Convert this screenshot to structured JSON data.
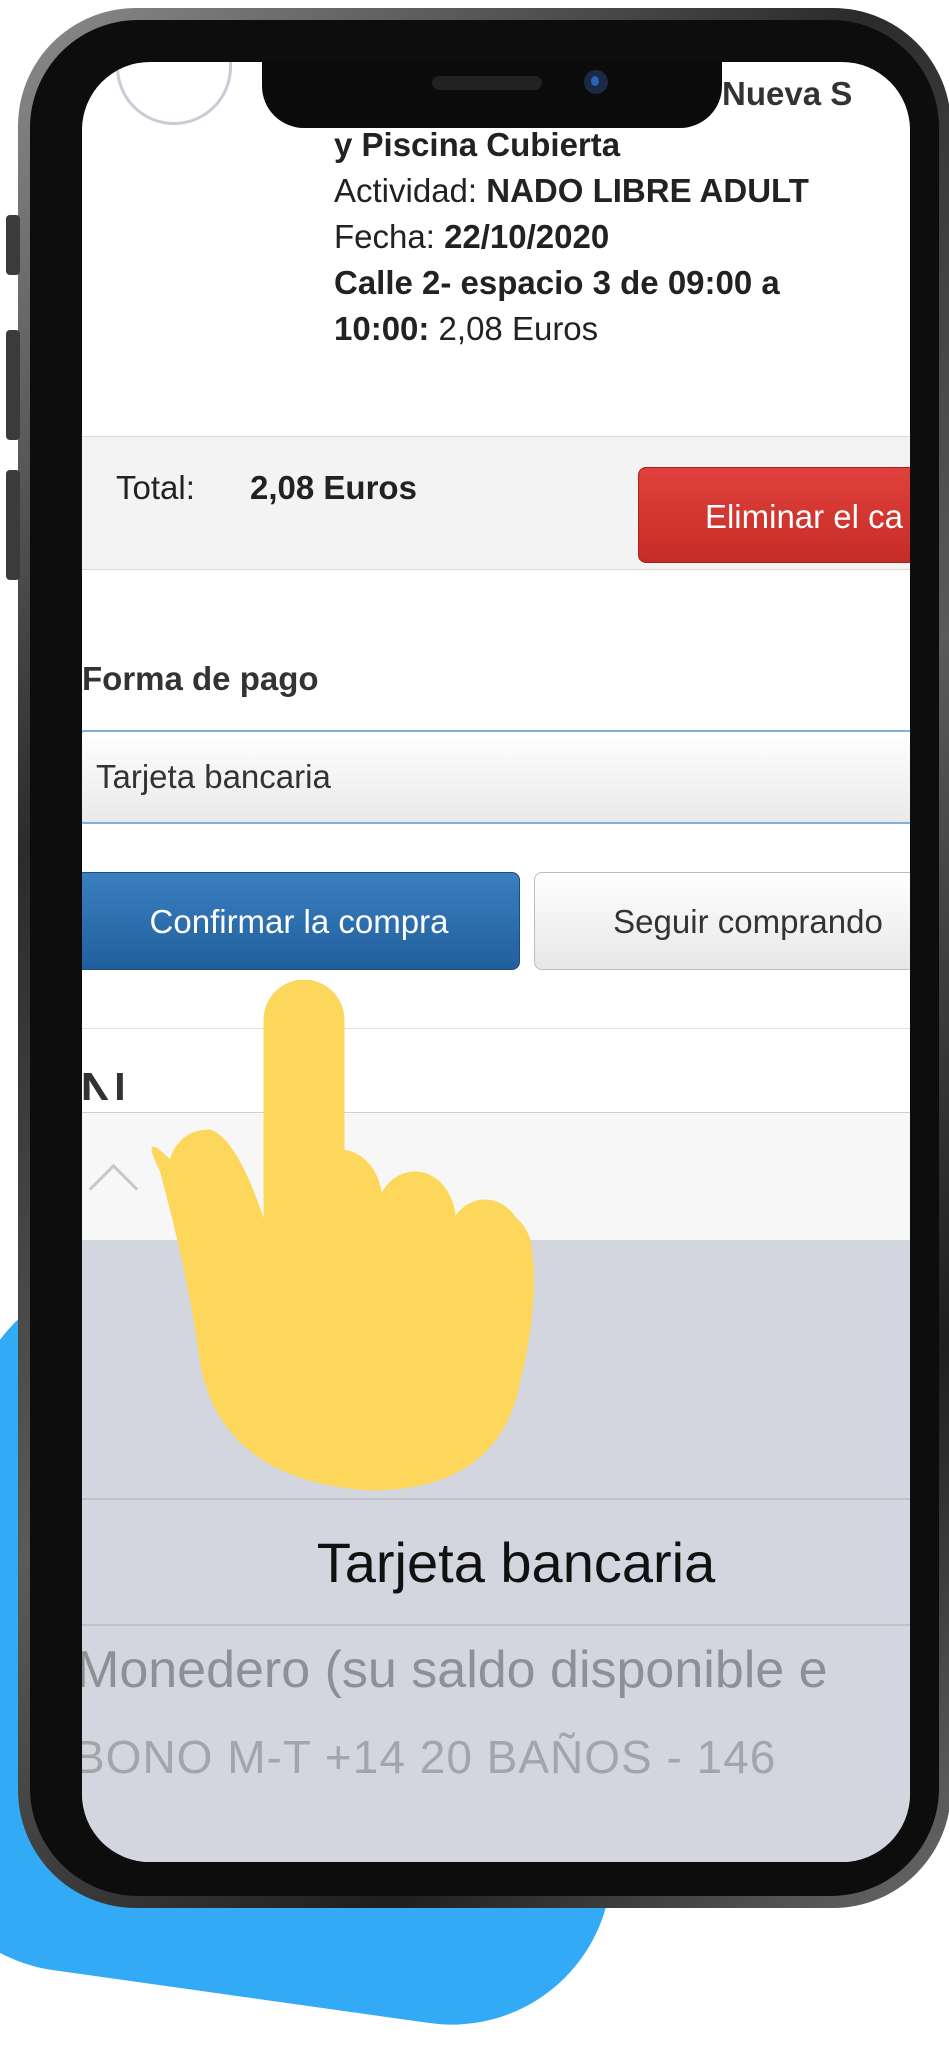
{
  "header": {
    "facility_fragment": "Nueva S",
    "facility_line2": "y Piscina Cubierta",
    "activity_label": "Actividad: ",
    "activity_value": "NADO LIBRE ADULT",
    "date_label": "Fecha: ",
    "date_value": "22/10/2020",
    "slot_line1": "Calle 2- espacio 3 de 09:00 a",
    "slot_time_end": "10:00:",
    "slot_price": " 2,08 Euros"
  },
  "cart": {
    "total_label": "Total:",
    "total_value": "2,08 Euros",
    "remove_button": "Eliminar el ca"
  },
  "payment": {
    "label": "Forma de pago",
    "selected": "Tarjeta bancaria"
  },
  "actions": {
    "confirm_button": "Confirmar la compra",
    "continue_button": "Seguir comprando"
  },
  "partial_heading": "N",
  "picker": {
    "options": [
      "Tarjeta bancaria",
      "Monedero (su saldo disponible e",
      "BONO M-T +14 20 BAÑOS - 146"
    ]
  },
  "colors": {
    "accent_blue": "#33aaf5",
    "confirm_blue": "#2a6cad",
    "remove_red": "#d9362f",
    "hand_yellow": "#fdd75c"
  },
  "icons": [
    "chevron-up-icon",
    "chevron-down-icon",
    "pointing-hand-icon"
  ]
}
